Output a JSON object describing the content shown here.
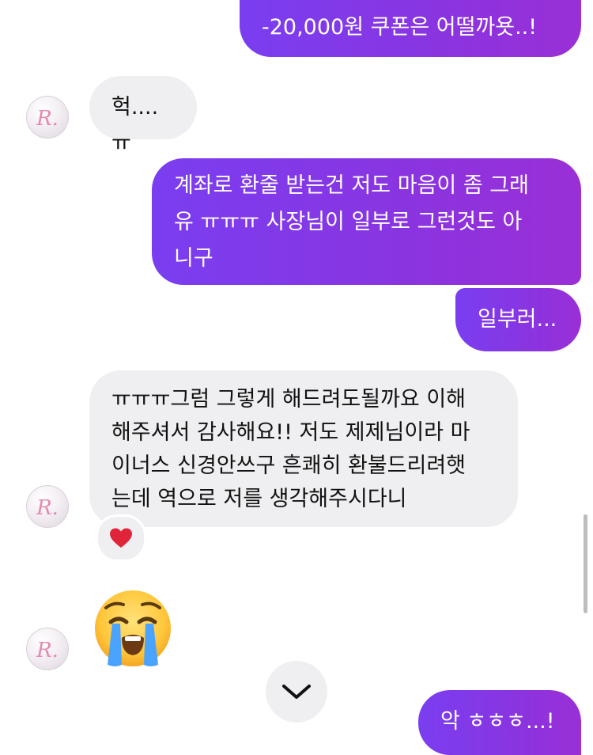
{
  "messages": [
    {
      "side": "me",
      "text": "-20,000원 쿠폰은 어떨까욧..!"
    },
    {
      "side": "them",
      "text": "헉....ㅠ"
    },
    {
      "side": "me",
      "text": "계좌로 환줄 받는건 저도 마음이 좀 그래\n유 ㅠㅠㅠ 사장님이 일부로 그런것도 아\n니구"
    },
    {
      "side": "me",
      "text": "일부러..."
    },
    {
      "side": "them",
      "text": "ㅠㅠㅠ그럼 그렇게 해드려도될까요 이해\n해주셔서 감사해요!! 저도 제제님이라 마\n이너스 신경안쓰구 흔쾌히 환불드리려햇\n는데 역으로 저를 생각해주시다니"
    },
    {
      "side": "me",
      "text": "악 ㅎㅎㅎ...!"
    }
  ],
  "reaction": {
    "icon": "heart-icon",
    "color": "#e0243a"
  },
  "crying_emoji": {
    "icon": "loudly-crying-face-emoji"
  },
  "avatar": {
    "letter": "R.",
    "color": "#e58ab0"
  },
  "scroll_button": {
    "icon": "chevron-down-icon"
  },
  "colors": {
    "outgoing": "#7a3ef0",
    "incoming": "#efeff1"
  }
}
